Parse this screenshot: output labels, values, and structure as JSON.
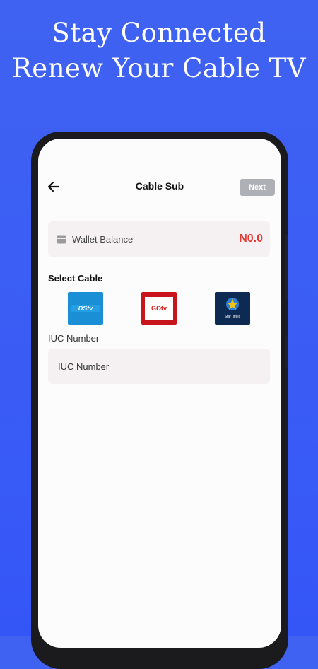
{
  "banner": {
    "line1": "Stay Connected",
    "line2": "Renew Your Cable TV"
  },
  "header": {
    "title": "Cable Sub",
    "next_label": "Next",
    "back_icon": "arrow-left-icon"
  },
  "wallet": {
    "label": "Wallet Balance",
    "amount": "N0.0",
    "icon": "wallet-card-icon",
    "amount_color": "#e53935"
  },
  "cable": {
    "section_title": "Select Cable",
    "providers": [
      {
        "name": "DStv",
        "logo_text": "DStv"
      },
      {
        "name": "GOtv",
        "logo_text": "GOtv"
      },
      {
        "name": "StarTimes",
        "logo_text": "StarTimes"
      }
    ]
  },
  "iuc": {
    "label": "IUC Number",
    "placeholder": "IUC Number",
    "value": ""
  },
  "colors": {
    "background": "#3a5cf5",
    "next_button": "#aeb0b5",
    "field_background": "#f5f1f3"
  }
}
